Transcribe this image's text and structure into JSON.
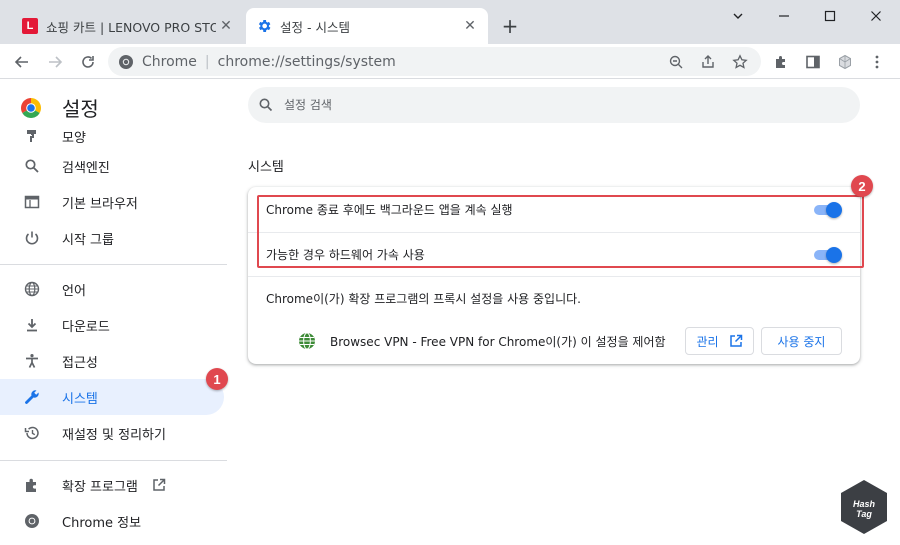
{
  "tabs": [
    {
      "title": "쇼핑 카트 | LENOVO PRO STORE",
      "favicon": "L"
    },
    {
      "title": "설정 - 시스템",
      "favicon": "gear-icon"
    }
  ],
  "omnibox": {
    "origin": "Chrome",
    "separator": "|",
    "url": "chrome://settings/system"
  },
  "sidebar": {
    "title": "설정",
    "items": [
      {
        "label": "모양",
        "icon": "paint-icon"
      },
      {
        "label": "검색엔진",
        "icon": "search-icon"
      },
      {
        "label": "기본 브라우저",
        "icon": "browser-icon"
      },
      {
        "label": "시작 그룹",
        "icon": "power-icon"
      },
      {
        "label": "언어",
        "icon": "globe-icon"
      },
      {
        "label": "다운로드",
        "icon": "download-icon"
      },
      {
        "label": "접근성",
        "icon": "accessibility-icon"
      },
      {
        "label": "시스템",
        "icon": "wrench-icon",
        "active": true
      },
      {
        "label": "재설정 및 정리하기",
        "icon": "restore-icon"
      },
      {
        "label": "확장 프로그램",
        "icon": "puzzle-icon"
      },
      {
        "label": "Chrome 정보",
        "icon": "chrome-icon"
      }
    ]
  },
  "search": {
    "placeholder": "설정 검색"
  },
  "section": {
    "title": "시스템"
  },
  "settings": {
    "background_apps": {
      "label": "Chrome 종료 후에도 백그라운드 앱을 계속 실행",
      "enabled": true
    },
    "hardware_accel": {
      "label": "가능한 경우 하드웨어 가속 사용",
      "enabled": true
    },
    "proxy_label": "Chrome이(가) 확장 프로그램의 프록시 설정을 사용 중입니다.",
    "extension": {
      "name": "Browsec VPN - Free VPN for Chrome이(가) 이 설정을 제어함",
      "manage_label": "관리",
      "disable_label": "사용 중지"
    }
  },
  "annotations": {
    "badge1": "1",
    "badge2": "2",
    "highlight_color": "#e0484f"
  },
  "watermark": {
    "line1": "Hash",
    "line2": "Tag"
  },
  "colors": {
    "accent": "#1a73e8",
    "active_bg": "#e8f0fe",
    "titlebar": "#dee1e6"
  }
}
